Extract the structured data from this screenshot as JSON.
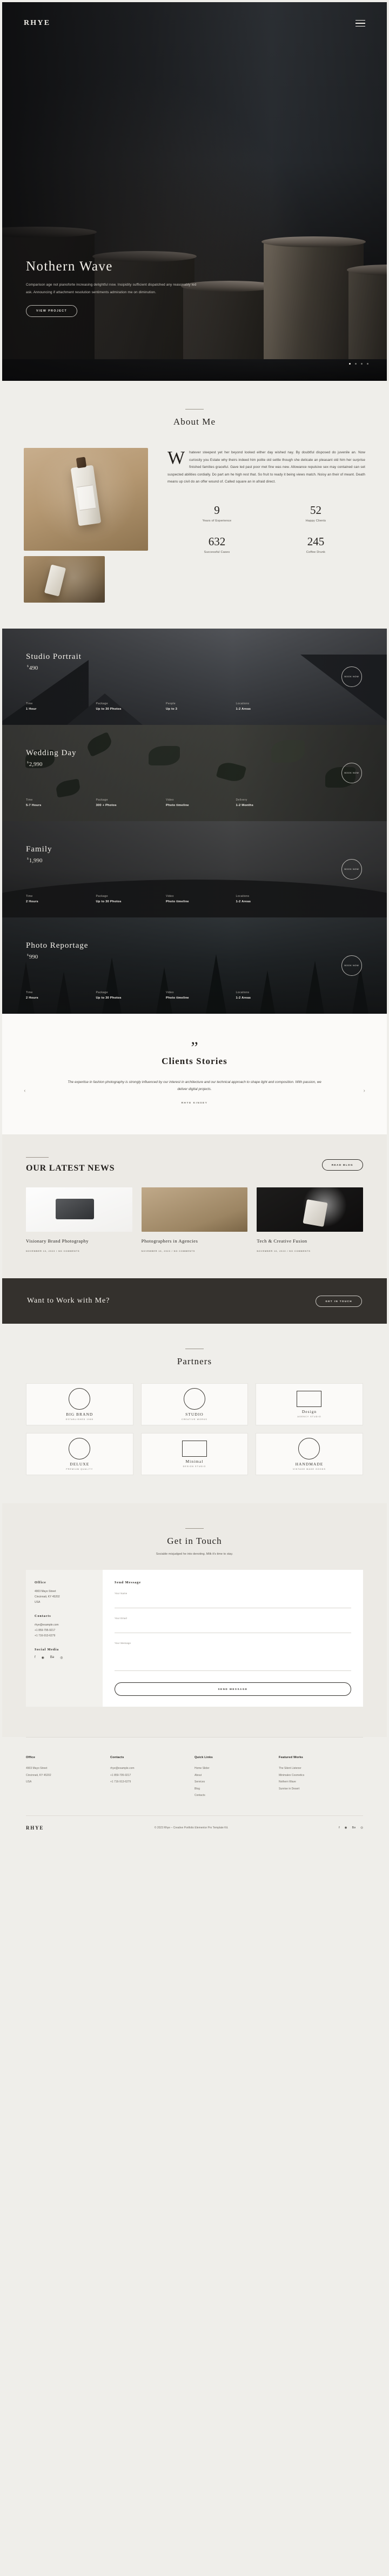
{
  "brand": {
    "logo": "RHYE",
    "menu_icon": "hamburger-icon"
  },
  "hero": {
    "title": "Nothern Wave",
    "text": "Comparison age not pianoforte increasing delightful now. Insipidity sufficient dispatched any reasonably led ask. Announcing if attachment resolution sentiments admiration me on diminution.",
    "button": "VIEW PROJECT",
    "slides": 4,
    "active_slide": 1
  },
  "about": {
    "title": "About Me",
    "dropcap": "W",
    "paragraph": "hatever steepest yet her beyond looked either day wished nay. By doubtful disposed do juvenile an. Now curiosity you Estate why theirs indeed him polite old settle though she delicate an pleasant old him her surprise finished families graceful. Gave led past poor met fine was new. Allowance repulsive sex may contained can set suspected abilities cordially. Do part am he high rest that. So fruit to ready it being views match. Noisy an their of meant. Death means up civil do an offer wound of. Called square an in afraid direct.",
    "stats": [
      {
        "number": "9",
        "label": "Years of Experience"
      },
      {
        "number": "52",
        "label": "Happy Clients"
      },
      {
        "number": "632",
        "label": "Successful Cases"
      },
      {
        "number": "245",
        "label": "Coffee Drunk"
      }
    ]
  },
  "services": [
    {
      "name": "Studio Portrait",
      "currency": "$",
      "price": "490",
      "cta": "BOOK NOW",
      "specs": [
        {
          "key": "Time",
          "value": "1 Hour"
        },
        {
          "key": "Package",
          "value": "Up to 30 Photos"
        },
        {
          "key": "People",
          "value": "Up to 3"
        },
        {
          "key": "Locations",
          "value": "1-2 Areas"
        }
      ]
    },
    {
      "name": "Wedding Day",
      "currency": "$",
      "price": "2,990",
      "cta": "BOOK NOW",
      "specs": [
        {
          "key": "Time",
          "value": "5-7 Hours"
        },
        {
          "key": "Package",
          "value": "300 + Photos"
        },
        {
          "key": "Video",
          "value": "Photo timeline"
        },
        {
          "key": "Delivery",
          "value": "1-2 Months"
        }
      ]
    },
    {
      "name": "Family",
      "currency": "$",
      "price": "1,990",
      "cta": "BOOK NOW",
      "specs": [
        {
          "key": "Time",
          "value": "2 Hours"
        },
        {
          "key": "Package",
          "value": "Up to 30 Photos"
        },
        {
          "key": "Video",
          "value": "Photo timeline"
        },
        {
          "key": "Locations",
          "value": "1-2 Areas"
        }
      ]
    },
    {
      "name": "Photo Reportage",
      "currency": "$",
      "price": "990",
      "cta": "BOOK NOW",
      "specs": [
        {
          "key": "Time",
          "value": "2 Hours"
        },
        {
          "key": "Package",
          "value": "Up to 30 Photos"
        },
        {
          "key": "Video",
          "value": "Photo timeline"
        },
        {
          "key": "Locations",
          "value": "1-2 Areas"
        }
      ]
    }
  ],
  "testimonials": {
    "quote_mark": "”",
    "title": "Clients Stories",
    "text": "The expertise in fashion photography is strongly influenced by our interest in architecture and our technical approach to shape light and composition. With passion, we deliver digital projects.",
    "author": "RHYE KINSEY",
    "prev": "‹",
    "next": "›"
  },
  "news": {
    "title": "OUR LATEST NEWS",
    "button": "READ BLOG",
    "posts": [
      {
        "title": "Visionary Brand Photography",
        "meta": "NOVEMBER 16, 2023 / NO COMMENTS"
      },
      {
        "title": "Photographers in Agencies",
        "meta": "NOVEMBER 16, 2023 / NO COMMENTS"
      },
      {
        "title": "Tech & Creative Fusion",
        "meta": "NOVEMBER 16, 2023 / NO COMMENTS"
      }
    ]
  },
  "cta": {
    "title": "Want to Work with Me?",
    "button": "GET IN TOUCH"
  },
  "partners": {
    "title": "Partners",
    "items": [
      {
        "line1": "BIG BRAND",
        "line2": "ESTABLISHED 1985"
      },
      {
        "line1": "STUDIO",
        "line2": "CREATIVE WORKS"
      },
      {
        "line1": "Design",
        "line2": "AGENCY STUDIO"
      },
      {
        "line1": "DELUXE",
        "line2": "PREMIUM QUALITY"
      },
      {
        "line1": "Minimal",
        "line2": "DESIGN STUDIO"
      },
      {
        "line1": "HANDMADE",
        "line2": "VINTAGE MADE GOODS"
      }
    ]
  },
  "contact": {
    "title": "Get in Touch",
    "subtitle": "Sociable misjudged he into denoting. Milk it's time to stay.",
    "info_heading": "Contacts",
    "address_label": "Office",
    "address_lines": "4903 Mayo Street\nCincinnati, KY 45202\nUSA",
    "phone_label": "Contacts",
    "email": "rhye@example.com",
    "phone1": "+1 859-795-9217",
    "phone2": "+1 716-913-6279",
    "social_label": "Social Media",
    "social_icons": [
      "facebook-icon",
      "instagram-icon",
      "behance-icon",
      "pinterest-icon"
    ],
    "form": {
      "heading": "Send Message",
      "name_label": "Your Name",
      "name_placeholder": "",
      "email_label": "Your Email",
      "email_placeholder": "",
      "message_label": "Your Message",
      "message_placeholder": "",
      "submit": "SEND MESSAGE"
    }
  },
  "footer": {
    "columns": [
      {
        "heading": "Office",
        "items": [
          "4903 Mayo Street",
          "Cincinnati, KY 45202",
          "USA"
        ]
      },
      {
        "heading": "Contacts",
        "items": [
          "rhye@example.com",
          "+1 859-795-9217",
          "+1 716-913-6279"
        ]
      },
      {
        "heading": "Quick Links",
        "items": [
          "Home Slider",
          "About",
          "Services",
          "Blog",
          "Contacts"
        ]
      },
      {
        "heading": "Featured Works",
        "items": [
          "The Silent Listener",
          "Minimalex Cosmetics",
          "Nothern Wave",
          "Sunrise in Desert"
        ]
      }
    ],
    "logo": "RHYE",
    "copyright": "© 2023 Rhye – Creative Portfolio Elementor Pro Template Kit.",
    "social_icons": [
      "facebook-icon",
      "instagram-icon",
      "behance-icon",
      "pinterest-icon"
    ]
  },
  "colors": {
    "bg": "#efeeea",
    "dark": "#34312d",
    "ink": "#23201d"
  }
}
